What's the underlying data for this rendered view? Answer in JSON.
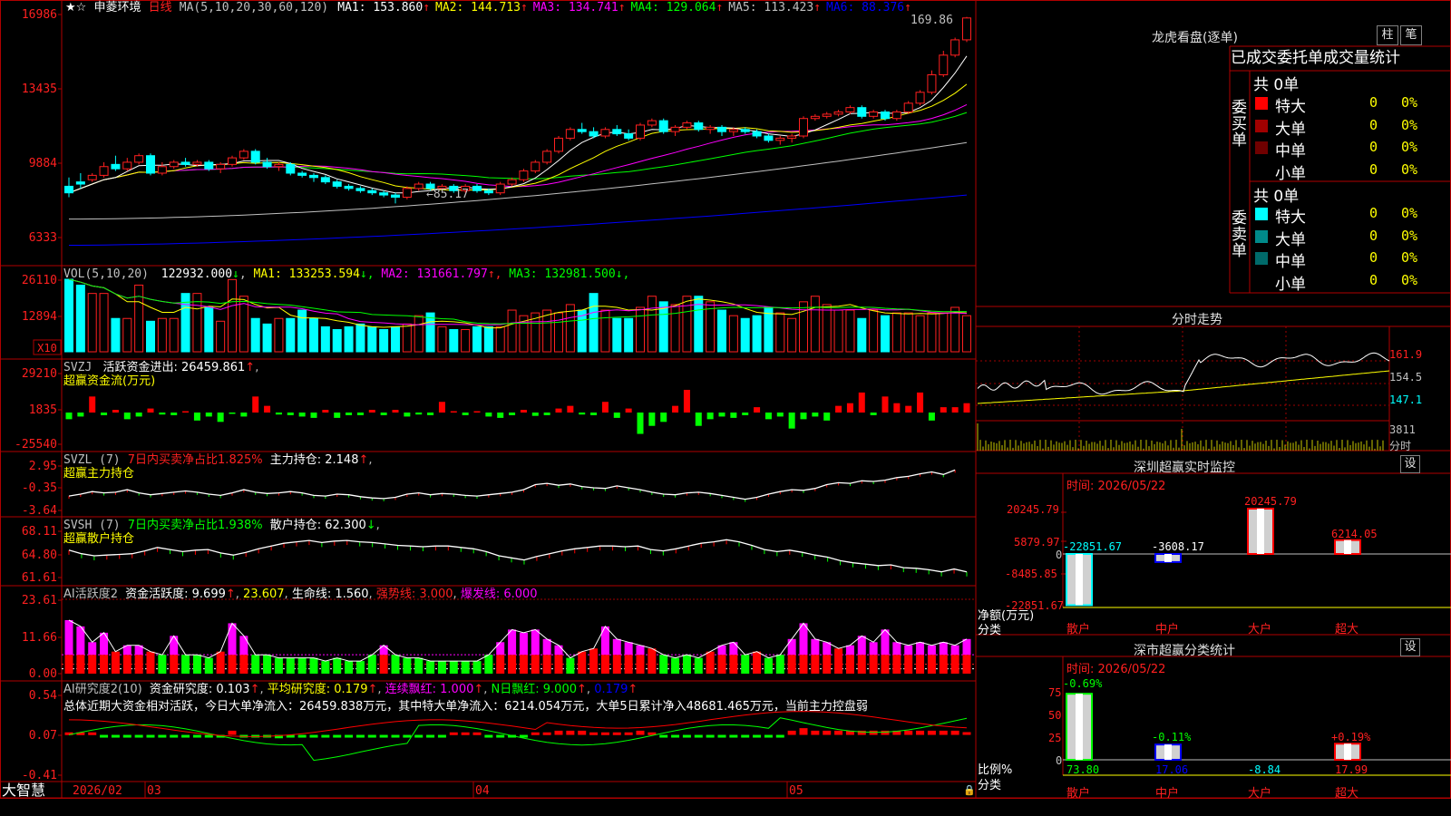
{
  "main": {
    "star": "★",
    "star2": "☆",
    "stock_name": "申菱环境",
    "period": "日线",
    "ma_header": "MA(5,10,20,30,60,120)",
    "ma": [
      {
        "label": "MA1: 153.860",
        "arrow": "↑",
        "color": "#ffffff"
      },
      {
        "label": "MA2: 144.713",
        "arrow": "↑",
        "color": "#ffff00"
      },
      {
        "label": "MA3: 134.741",
        "arrow": "↑",
        "color": "#ff00ff"
      },
      {
        "label": "MA4: 129.064",
        "arrow": "↑",
        "color": "#00ff00"
      },
      {
        "label": "MA5: 113.423",
        "arrow": "↑",
        "color": "#c0c0c0"
      },
      {
        "label": "MA6: 88.376",
        "arrow": "↑",
        "color": "#0000ff"
      }
    ],
    "y_ticks": [
      "16986",
      "13435",
      "9884",
      "6333"
    ],
    "high_label": "169.86",
    "low_label": "←85.17"
  },
  "volume": {
    "header": "VOL(5,10,20)",
    "value": "122932.000",
    "value_arrow": "↓",
    "ma": [
      {
        "label": "MA1: 133253.594",
        "arrow": "↓",
        "color": "#ffff00"
      },
      {
        "label": "MA2: 131661.797",
        "arrow": "↑",
        "color": "#ff00ff"
      },
      {
        "label": "MA3: 132981.500",
        "arrow": "↓",
        "color": "#00ff00"
      }
    ],
    "y_ticks": [
      "26110",
      "12894"
    ],
    "unit": "X10"
  },
  "svzj": {
    "header": "SVZJ",
    "label": "活跃资金进出: 26459.861",
    "arrow": "↑",
    "sub": "超赢资金流(万元)",
    "y_ticks": [
      "29210",
      "1835",
      "-25540"
    ]
  },
  "svzl": {
    "header": "SVZL (7)",
    "pct": "7日内买卖净占比1.825%",
    "hold": "主力持仓: 2.148",
    "arrow": "↑",
    "sub": "超赢主力持仓",
    "y_ticks": [
      "2.95",
      "-0.35",
      "-3.64"
    ]
  },
  "svsh": {
    "header": "SVSH (7)",
    "pct": "7日内买卖净占比1.938%",
    "hold": "散户持仓: 62.300",
    "arrow": "↓",
    "sub": "超赢散户持仓",
    "y_ticks": [
      "68.11",
      "64.80",
      "61.61"
    ]
  },
  "ai1": {
    "header": "AI活跃度2",
    "active": "资金活跃度: 9.699",
    "a1": "↑",
    "v2": "23.607",
    "life": "生命线: 1.560",
    "strong": "强势线: 3.000",
    "burst": "爆发线: 6.000",
    "y_ticks": [
      "23.61",
      "11.66",
      "0.00"
    ]
  },
  "ai2": {
    "header": "AI研究度2(10)",
    "research": "资金研究度: 0.103",
    "avg": "平均研究度: 0.179",
    "cont": "连续飘红: 1.000",
    "nday": "N日飘红: 9.000",
    "nv": "0.179",
    "summary": "总体近期大资金相对活跃，今日大单净流入：26459.838万元，其中特大单净流入：6214.054万元，大单5日累计净入48681.465万元，当前主力控盘弱",
    "y_ticks": [
      "0.54",
      "0.07",
      "-0.41"
    ]
  },
  "bottom": {
    "brand": "大智慧",
    "date1": "2026/02",
    "m3": "03",
    "m4": "04",
    "m5": "05"
  },
  "right": {
    "lhb_title": "龙虎看盘(逐单)",
    "btn_bar": "柱",
    "btn_pen": "笔",
    "stats_title": "已成交委托单成交量统计",
    "buy_side": "委买单",
    "sell_side": "委卖单",
    "buy_total": "共 0单",
    "sell_total": "共 0单",
    "buy_rows": [
      {
        "name": "特大",
        "n": "0",
        "pct": "0%",
        "color": "#ff0000"
      },
      {
        "name": "大单",
        "n": "0",
        "pct": "0%",
        "color": "#a00000"
      },
      {
        "name": "中单",
        "n": "0",
        "pct": "0%",
        "color": "#700000"
      },
      {
        "name": "小单",
        "n": "0",
        "pct": "0%",
        "color": ""
      }
    ],
    "sell_rows": [
      {
        "name": "特大",
        "n": "0",
        "pct": "0%",
        "color": "#00ffff"
      },
      {
        "name": "大单",
        "n": "0",
        "pct": "0%",
        "color": "#008a8a"
      },
      {
        "name": "中单",
        "n": "0",
        "pct": "0%",
        "color": "#006a6a"
      },
      {
        "name": "小单",
        "n": "0",
        "pct": "0%",
        "color": ""
      }
    ],
    "intraday_title": "分时走势",
    "intraday_ticks": [
      "161.9",
      "154.5",
      "147.1",
      "3811",
      "分时"
    ],
    "monitor_title": "深圳超赢实时监控",
    "monitor_btn": "设",
    "monitor_time": "时间: 2026/05/22",
    "monitor_ticks": [
      "20245.79",
      "5879.97",
      "0",
      "-8485.85",
      "-22851.67"
    ],
    "monitor_unit": "净额(万元)",
    "monitor_axis": "分类",
    "categories": [
      "散户",
      "中户",
      "大户",
      "超大"
    ],
    "monitor_values": [
      "-22851.67",
      "-3608.17",
      "20245.79",
      "6214.05"
    ],
    "class_title": "深市超赢分类统计",
    "class_btn": "设",
    "class_time": "时间: 2026/05/22",
    "class_ticks": [
      "75",
      "50",
      "25",
      "0"
    ],
    "class_unit": "比例%",
    "class_axis": "分类",
    "class_top": [
      "-0.69%",
      "-0.11%",
      "",
      "+0.19%"
    ],
    "class_bottom": [
      "73.80",
      "17.06",
      "-8.84",
      "17.99"
    ]
  },
  "chart_data": [
    {
      "type": "candlestick",
      "title": "申菱环境 日线",
      "x": [
        "2026/02",
        "03",
        "04",
        "05"
      ],
      "ylim": [
        6333,
        16986
      ],
      "ohlc": [
        [
          93,
          90,
          97,
          88
        ],
        [
          95,
          94,
          99,
          92
        ],
        [
          96,
          98,
          99,
          95
        ],
        [
          98,
          102,
          104,
          97
        ],
        [
          103,
          101,
          107,
          100
        ],
        [
          101,
          104,
          106,
          100
        ],
        [
          104,
          107,
          108,
          103
        ],
        [
          107,
          99,
          108,
          98
        ],
        [
          99,
          102,
          104,
          98
        ],
        [
          102,
          104,
          105,
          101
        ],
        [
          104,
          103,
          106,
          102
        ],
        [
          103,
          104,
          105,
          102
        ],
        [
          104,
          101,
          105,
          100
        ],
        [
          101,
          103,
          104,
          99
        ],
        [
          103,
          106,
          107,
          102
        ],
        [
          106,
          109,
          110,
          105
        ],
        [
          109,
          104,
          110,
          103
        ],
        [
          104,
          102,
          106,
          101
        ],
        [
          102,
          103,
          104,
          100
        ],
        [
          103,
          99,
          104,
          98
        ],
        [
          99,
          98,
          100,
          97
        ],
        [
          98,
          97,
          99,
          95
        ],
        [
          97,
          95,
          98,
          94
        ],
        [
          95,
          93,
          96,
          92
        ],
        [
          93,
          92,
          94,
          91
        ],
        [
          92,
          91,
          93,
          90
        ],
        [
          91,
          90,
          92,
          89
        ],
        [
          90,
          89,
          91,
          88
        ],
        [
          89,
          88,
          90,
          85.17
        ],
        [
          88,
          92,
          93,
          87
        ],
        [
          92,
          94,
          95,
          91
        ],
        [
          94,
          92,
          95,
          91
        ],
        [
          92,
          93,
          94,
          91
        ],
        [
          93,
          91,
          94,
          90
        ],
        [
          91,
          93,
          94,
          90
        ],
        [
          93,
          91,
          94,
          90
        ],
        [
          91,
          90,
          92,
          89
        ],
        [
          90,
          94,
          95,
          89
        ],
        [
          94,
          96,
          97,
          93
        ],
        [
          96,
          100,
          101,
          95
        ],
        [
          100,
          104,
          105,
          99
        ],
        [
          104,
          109,
          110,
          103
        ],
        [
          109,
          115,
          116,
          108
        ],
        [
          115,
          119,
          120,
          114
        ],
        [
          119,
          118,
          122,
          117
        ],
        [
          118,
          116,
          120,
          115
        ],
        [
          116,
          119,
          120,
          115
        ],
        [
          119,
          117,
          121,
          116
        ],
        [
          117,
          115,
          119,
          114
        ],
        [
          115,
          121,
          122,
          114
        ],
        [
          121,
          123,
          124,
          120
        ],
        [
          123,
          118,
          124,
          117
        ],
        [
          118,
          120,
          121,
          116
        ],
        [
          120,
          122,
          123,
          119
        ],
        [
          122,
          119,
          123,
          118
        ],
        [
          119,
          120,
          121,
          117
        ],
        [
          120,
          118,
          121,
          116
        ],
        [
          118,
          119,
          120,
          116
        ],
        [
          119,
          118,
          120,
          117
        ],
        [
          118,
          116,
          119,
          115
        ],
        [
          116,
          114,
          117,
          113
        ],
        [
          114,
          115,
          116,
          112
        ],
        [
          115,
          116,
          117,
          113
        ],
        [
          116,
          124,
          125,
          115
        ],
        [
          124,
          125,
          126,
          123
        ],
        [
          125,
          126,
          127,
          124
        ],
        [
          126,
          127,
          128,
          125
        ],
        [
          127,
          129,
          130,
          126
        ],
        [
          129,
          125,
          130,
          124
        ],
        [
          125,
          127,
          128,
          124
        ],
        [
          127,
          124,
          128,
          123
        ],
        [
          124,
          127,
          128,
          123
        ],
        [
          127,
          131,
          132,
          126
        ],
        [
          131,
          136,
          137,
          130
        ],
        [
          136,
          144,
          146,
          135
        ],
        [
          144,
          153,
          155,
          143
        ],
        [
          153,
          160,
          161,
          152
        ],
        [
          160,
          170,
          170.5,
          159
        ]
      ]
    },
    {
      "type": "bar",
      "title": "VOL",
      "ylim": [
        0,
        26110
      ],
      "values": [
        26110,
        24000,
        21000,
        21000,
        12000,
        12000,
        24000,
        11000,
        12000,
        12000,
        21000,
        21000,
        16000,
        11000,
        26000,
        20000,
        12000,
        10000,
        12000,
        12000,
        15000,
        12000,
        9000,
        8000,
        9000,
        10000,
        9000,
        8000,
        9000,
        10000,
        13000,
        14000,
        9000,
        8000,
        8000,
        9000,
        9000,
        9000,
        15000,
        13000,
        14000,
        15000,
        14000,
        17000,
        15000,
        21000,
        15000,
        12000,
        12000,
        16000,
        20000,
        18000,
        17000,
        20000,
        20000,
        18000,
        15000,
        13000,
        12000,
        13000,
        16000,
        14000,
        12000,
        18000,
        20000,
        17000,
        15000,
        15000,
        12000,
        15000,
        13000,
        14000,
        14000,
        13000,
        14000,
        14000,
        16000,
        13000
      ]
    },
    {
      "type": "bar",
      "title": "超赢资金流(万元)",
      "ylim": [
        -25540,
        29210
      ],
      "values": [
        -5000,
        -3000,
        12000,
        -2000,
        2000,
        -5000,
        -3000,
        3000,
        -1500,
        -2000,
        1000,
        -6000,
        -3000,
        -7000,
        -1000,
        -3000,
        12000,
        5000,
        -1500,
        -2000,
        -3000,
        -4000,
        2000,
        -4000,
        -2000,
        -2000,
        2000,
        -2000,
        2000,
        -3000,
        -1500,
        -2000,
        8000,
        1000,
        -2000,
        1000,
        -3000,
        -4000,
        -2000,
        2000,
        -2500,
        -2000,
        3000,
        5000,
        -1500,
        -2000,
        8000,
        -4000,
        3000,
        -16000,
        -10000,
        -7000,
        5000,
        17000,
        -10000,
        -5000,
        -3000,
        -4000,
        -2000,
        4000,
        -5000,
        -3000,
        -12000,
        -5000,
        -3000,
        -6000,
        5000,
        7000,
        15000,
        -2000,
        12000,
        7000,
        5000,
        15000,
        -6000,
        4000,
        4000,
        7000,
        10000,
        -15000,
        25000
      ]
    },
    {
      "type": "line",
      "title": "超赢主力持仓",
      "ylim": [
        -3.64,
        2.95
      ],
      "values": [
        -1.5,
        -1.2,
        -0.8,
        -1.0,
        -0.9,
        -0.5,
        -1.0,
        -1.3,
        -1.1,
        -0.9,
        -0.7,
        -0.9,
        -1.2,
        -1.4,
        -1.0,
        -0.5,
        -0.9,
        -1.1,
        -1.0,
        -0.8,
        -1.0,
        -1.4,
        -1.5,
        -1.2,
        -1.3,
        -1.6,
        -1.8,
        -1.9,
        -1.7,
        -1.2,
        -1.0,
        -1.3,
        -1.1,
        -1.2,
        -1.4,
        -1.5,
        -1.3,
        -1.1,
        -0.9,
        -0.5,
        0.3,
        0.5,
        0.2,
        0.4,
        0.0,
        -0.2,
        -0.3,
        0.1,
        -0.2,
        -0.5,
        -0.9,
        -1.2,
        -1.3,
        -1.0,
        -0.9,
        -1.1,
        -1.4,
        -1.7,
        -2.0,
        -1.7,
        -1.2,
        -0.8,
        -0.5,
        -0.6,
        -0.3,
        0.3,
        0.6,
        0.5,
        0.9,
        0.8,
        1.0,
        1.4,
        1.6,
        2.0,
        2.3,
        1.9,
        2.6
      ]
    },
    {
      "type": "line",
      "title": "超赢散户持仓",
      "ylim": [
        61.61,
        68.11
      ],
      "values": [
        65.4,
        64.9,
        64.6,
        64.7,
        64.8,
        64.9,
        65.3,
        65.8,
        65.5,
        65.2,
        65.4,
        65.5,
        65.0,
        64.7,
        65.1,
        65.6,
        66.0,
        66.4,
        66.6,
        66.8,
        66.5,
        66.7,
        66.8,
        66.6,
        66.5,
        66.3,
        66.1,
        66.0,
        65.9,
        66.0,
        66.0,
        65.8,
        65.6,
        65.2,
        64.6,
        64.3,
        64.0,
        64.5,
        64.9,
        65.3,
        65.6,
        65.8,
        66.0,
        66.0,
        65.9,
        66.0,
        65.5,
        65.3,
        65.6,
        66.0,
        66.4,
        66.6,
        66.9,
        66.6,
        66.1,
        65.5,
        65.2,
        65.4,
        65.1,
        64.7,
        64.4,
        63.9,
        63.6,
        63.4,
        63.2,
        63.3,
        62.9,
        62.8,
        62.6,
        62.3,
        62.7,
        62.3
      ]
    },
    {
      "type": "bar",
      "title": "AI活跃度2",
      "ylim": [
        0,
        23.61
      ],
      "values": [
        17,
        15,
        10,
        13,
        7,
        9,
        9,
        7,
        6,
        12,
        6,
        6,
        5,
        7,
        16,
        12,
        6,
        6,
        5,
        5,
        5,
        5,
        4,
        5,
        4,
        4,
        6,
        9,
        6,
        5,
        5,
        4,
        4,
        4,
        4,
        4,
        6,
        10,
        14,
        13,
        14,
        11,
        9,
        5,
        7,
        8,
        15,
        11,
        10,
        9,
        8,
        6,
        5,
        6,
        5,
        7,
        9,
        10,
        6,
        7,
        5,
        6,
        11,
        16,
        11,
        10,
        8,
        9,
        12,
        10,
        14,
        10,
        9,
        10,
        9,
        10,
        9,
        11
      ]
    },
    {
      "type": "bar",
      "title": "AI研究度2(10)",
      "ylim": [
        -0.41,
        0.54
      ],
      "values": [
        0.1,
        0.1,
        0.1,
        0.09,
        0.05,
        0.06,
        0.05,
        0.04,
        0.06,
        0.05,
        0.05,
        0.04,
        0.05,
        0.06,
        0.12,
        0.09,
        0.05,
        0.04,
        0.03,
        0.05,
        0.04,
        0.05,
        0.05,
        0.05,
        0.04,
        0.05,
        0.04,
        0.05,
        0.05,
        0.04,
        0.05,
        0.05,
        0.05,
        0.1,
        0.1,
        0.1,
        0.06,
        0.06,
        0.06,
        0.06,
        0.1,
        0.1,
        0.12,
        0.12,
        0.12,
        0.1,
        0.1,
        0.1,
        0.1,
        0.12,
        0.1,
        0.09,
        0.08,
        0.06,
        0.05,
        0.05,
        0.04,
        0.05,
        0.06,
        0.06,
        0.05,
        0.06,
        0.12,
        0.15,
        0.12,
        0.12,
        0.12,
        0.12,
        0.12,
        0.12,
        0.12,
        0.12,
        0.12,
        0.12,
        0.12,
        0.12,
        0.12,
        0.103
      ]
    },
    {
      "type": "bar",
      "title": "深圳超赢实时监控",
      "categories": [
        "散户",
        "中户",
        "大户",
        "超大"
      ],
      "values": [
        -22851.67,
        -3608.17,
        20245.79,
        6214.05
      ],
      "ylim": [
        -22851.67,
        20245.79
      ],
      "ylabel": "净额(万元)",
      "xlabel": "分类"
    },
    {
      "type": "bar",
      "title": "深市超赢分类统计",
      "categories": [
        "散户",
        "中户",
        "大户",
        "超大"
      ],
      "values": [
        73.8,
        17.06,
        -8.84,
        17.99
      ],
      "ylim": [
        0,
        75
      ],
      "ylabel": "比例%",
      "xlabel": "分类"
    }
  ]
}
